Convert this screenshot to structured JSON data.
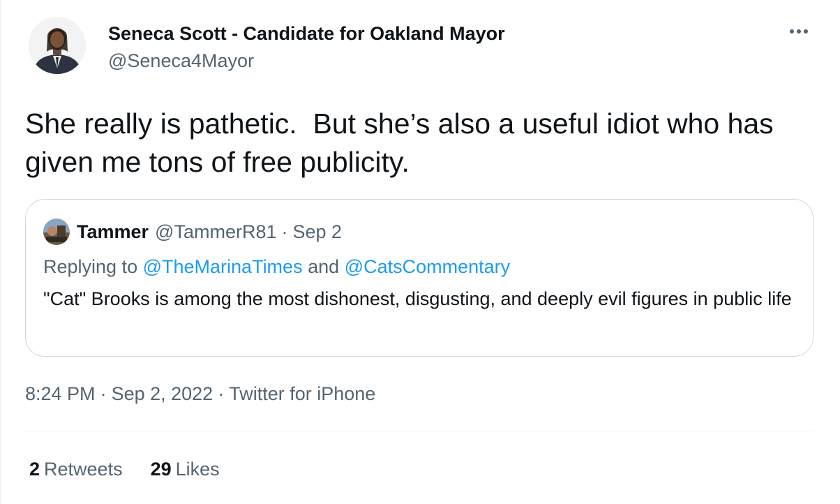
{
  "author": {
    "display_name": "Seneca Scott - Candidate for Oakland Mayor",
    "handle": "@Seneca4Mayor",
    "avatar_icon": "profile-photo"
  },
  "tweet": {
    "text": "She really is pathetic.  But she’s also a useful idiot who has given me tons of free publicity."
  },
  "quoted_tweet": {
    "name": "Tammer",
    "handle": "@TammerR81",
    "separator": "·",
    "date": "Sep 2",
    "replying_prefix": "Replying to",
    "reply_to_1": "@TheMarinaTimes",
    "reply_and": "and",
    "reply_to_2": "@CatsCommentary",
    "text": "\"Cat\" Brooks is among the most dishonest, disgusting, and deeply evil figures in public life"
  },
  "meta": {
    "time": "8:24 PM",
    "separator": "·",
    "date": "Sep 2, 2022",
    "source": "Twitter for iPhone"
  },
  "stats": {
    "retweets_count": "2",
    "retweets_label": "Retweets",
    "likes_count": "29",
    "likes_label": "Likes"
  },
  "colors": {
    "text": "#0f1419",
    "secondary": "#536471",
    "link": "#1d9bf0",
    "border": "#cfd9de"
  }
}
